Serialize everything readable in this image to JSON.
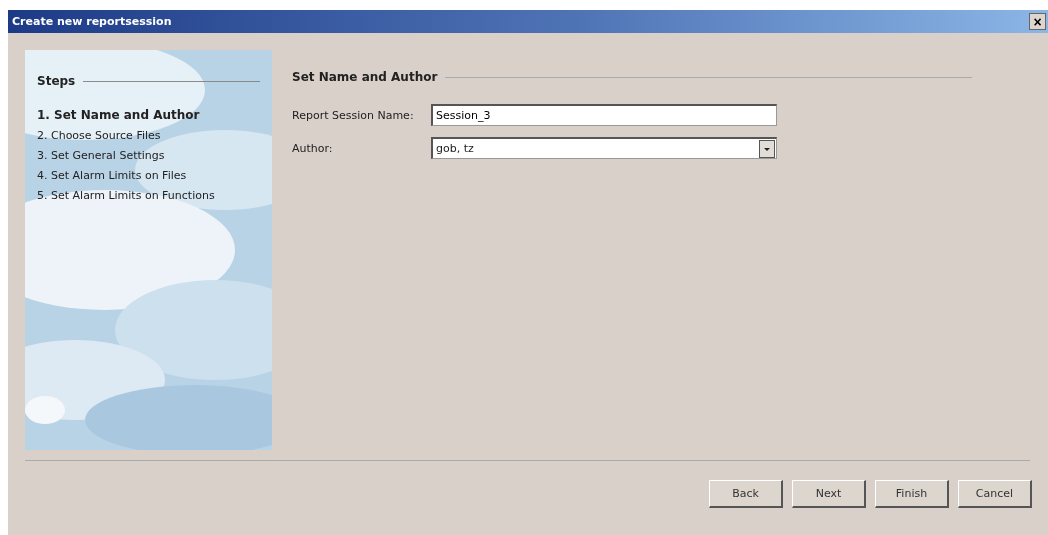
{
  "window": {
    "title": "Create new reportsession",
    "close": "×"
  },
  "steps": {
    "title": "Steps",
    "items": [
      {
        "label": "1. Set Name and Author",
        "selected": true
      },
      {
        "label": "2. Choose Source Files",
        "selected": false
      },
      {
        "label": "3. Set General Settings",
        "selected": false
      },
      {
        "label": "4. Set Alarm Limits on Files",
        "selected": false
      },
      {
        "label": "5. Set Alarm Limits on Functions",
        "selected": false
      }
    ]
  },
  "section": {
    "title": "Set Name and Author"
  },
  "fields": [
    {
      "kind": "text",
      "label": "Report Session Name:",
      "value": "Session_3"
    },
    {
      "kind": "dropdown",
      "label": "Author:",
      "value": "gob, tz"
    }
  ],
  "buttons": [
    "Back",
    "Next",
    "Finish",
    "Cancel"
  ]
}
